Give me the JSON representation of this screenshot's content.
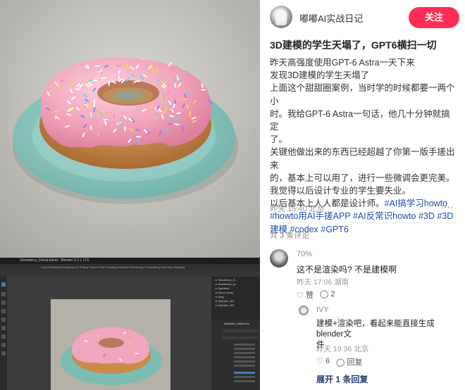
{
  "post": {
    "author": "嘟嘟AI实战日记",
    "follow_label": "关注",
    "title": "3D建模的学生天塌了，GPT6横扫一切",
    "lines": [
      "昨天高强度使用GPT-6 Astra一天下来",
      "发现3D建模的学生天塌了",
      "上面这个甜甜圈案例，当时学的时候都要一两个小",
      "时。我给GPT-6 Astra一句话，他几十分钟就搞定",
      "了。",
      "关键他做出来的东西已经超越了你第一版手搓出来",
      "的，基本上可以用了，进行一些微调会更完美。",
      "我觉得以后设计专业的学生要失业。",
      "以后基本上人人都是设计师。#AI搞学习howto",
      "#howto用AI手搓APP #AI反常识howto #3D #3D",
      "建模 #codex #GPT6"
    ],
    "meta": "昨天 15:40 北京",
    "more_icon": "ellipsis-icon"
  },
  "comments": {
    "count_label": "共 3 条评论",
    "items": [
      {
        "user": "70%",
        "text": "这不是渲染吗? 不是建模啊",
        "time": "昨天 17:06 湖南",
        "like_label": "赞",
        "reply_count": "2"
      }
    ],
    "reply": {
      "user": "IVY",
      "text_line1": "建模+渲染吧，看起来能直接生成blender文",
      "text_line2": "件",
      "time": "昨天 19:36 北京",
      "like_count": "6",
      "reply_label": "回复"
    },
    "expand_label": "展开 1 条回复"
  },
  "blender": {
    "window_title": "Strawberry_Donut.blend - Blender 5.2.1 LTS",
    "menus": [
      "File",
      "Edit",
      "Render",
      "Window",
      "Help"
    ],
    "workspaces": [
      "Layout",
      "Modeling",
      "Sculpting",
      "UV Editing",
      "Texture Paint",
      "Shading",
      "Animation",
      "Rendering",
      "Compositing",
      "Geometry",
      "Scripting"
    ],
    "outliner_items": [
      "Strawberry_D...",
      "Strawberry_gl...",
      "Sprinkles",
      "Donut_body",
      "Icing",
      "Sprinkle_001",
      "Sprinkle_002"
    ],
    "properties_header": "Sprinkles_Instances",
    "colors": {
      "accent": "#ff2d55",
      "hashtag": "#1f4fa8",
      "icing": "#f3a7bf",
      "plate": "#8ec8c0",
      "dough": "#c98a4a"
    }
  }
}
